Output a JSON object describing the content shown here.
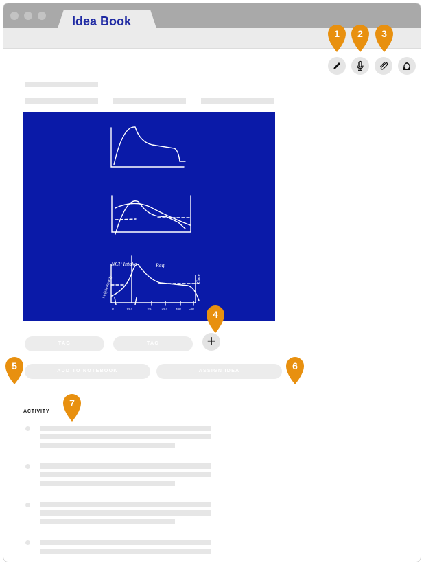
{
  "window": {
    "tab_title": "Idea Book"
  },
  "toolbar": {
    "tools": [
      {
        "name": "pencil-icon"
      },
      {
        "name": "microphone-icon"
      },
      {
        "name": "paperclip-icon"
      },
      {
        "name": "user-avatar-icon"
      }
    ]
  },
  "idea": {
    "tags": [
      "TAG",
      "TAG"
    ],
    "actions": {
      "add_to_notebook": "ADD TO NOTEBOOK",
      "assign_idea": "ASSIGN IDEA"
    }
  },
  "activity": {
    "heading": "ACTIVITY"
  },
  "sketch": {
    "annotations": {
      "top_label_left": "NCP Intake",
      "top_label_right": "Req.",
      "y_label": "weight/density",
      "right_label": "Core",
      "ticks": [
        "0",
        "100",
        "200",
        "300",
        "400",
        "500"
      ]
    }
  },
  "callouts": [
    "1",
    "2",
    "3",
    "4",
    "5",
    "6",
    "7"
  ],
  "colors": {
    "brand": "#1f2aa3",
    "canvas": "#0a1aa8",
    "callout": "#e8900f"
  }
}
